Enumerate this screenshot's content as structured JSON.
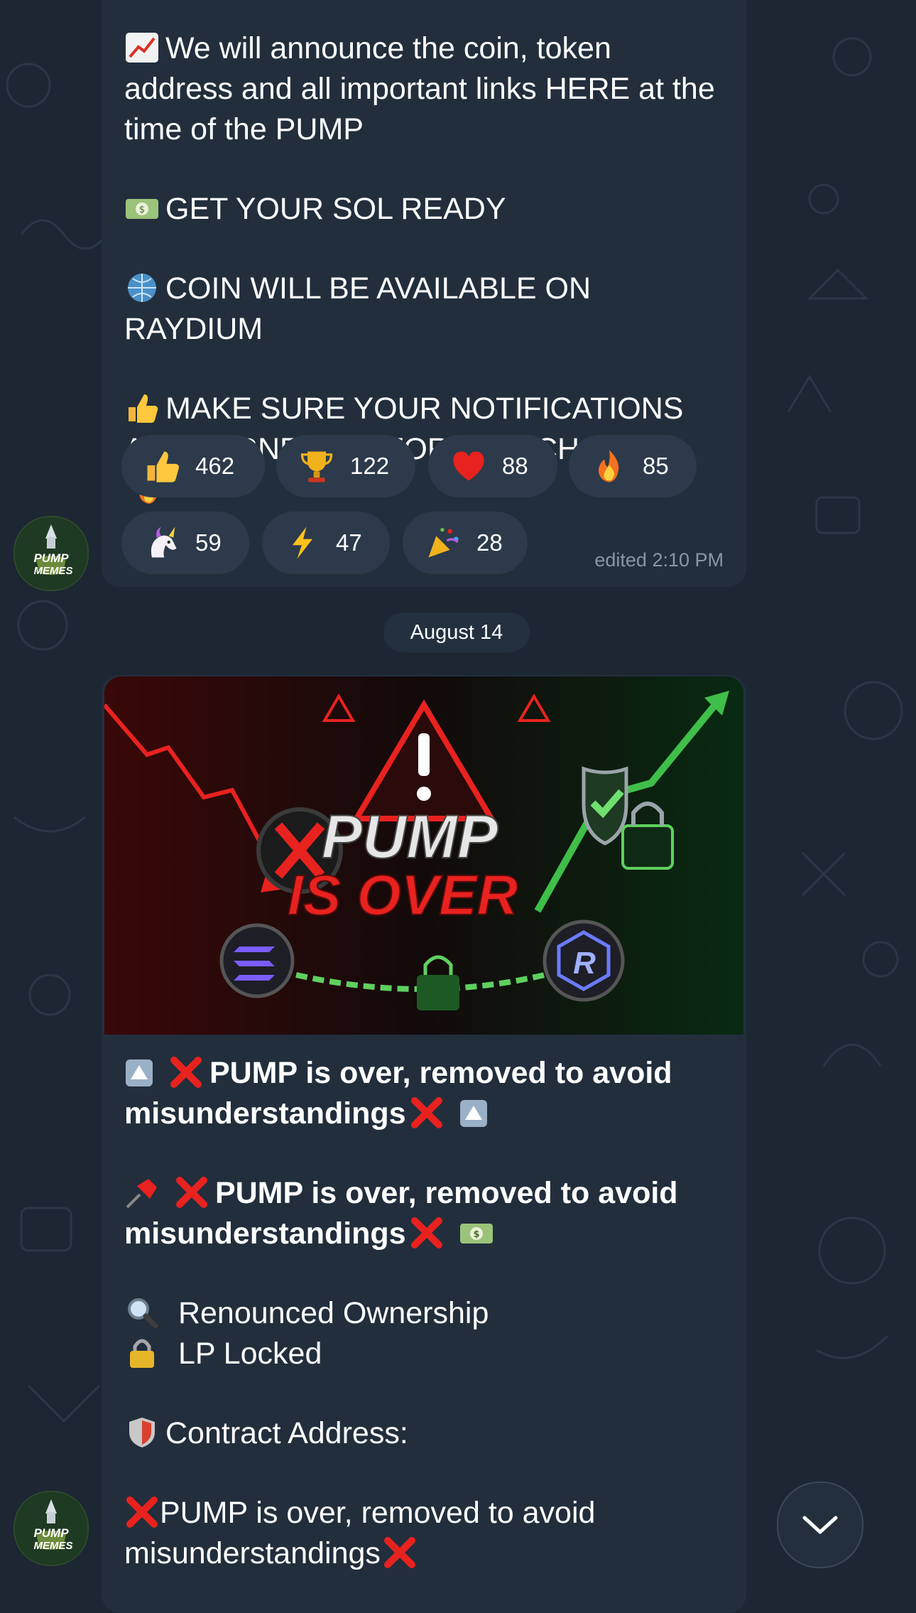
{
  "message1": {
    "line1": "We will announce the coin, token address and all important links HERE at the time of the PUMP",
    "line2": "GET YOUR SOL READY",
    "line3": "COIN WILL BE AVAILABLE ON RAYDIUM",
    "line4": "MAKE SURE YOUR NOTIFICATIONS ARE TURNED ON FOR THIS CHANNEL",
    "reactions": [
      {
        "emoji": "thumbs-up-icon",
        "count": "462"
      },
      {
        "emoji": "trophy-icon",
        "count": "122"
      },
      {
        "emoji": "heart-icon",
        "count": "88"
      },
      {
        "emoji": "fire-icon",
        "count": "85"
      },
      {
        "emoji": "unicorn-icon",
        "count": "59"
      },
      {
        "emoji": "lightning-icon",
        "count": "47"
      },
      {
        "emoji": "party-popper-icon",
        "count": "28"
      }
    ],
    "meta": "edited 2:10 PM"
  },
  "date_separator": "August 14",
  "message2": {
    "image_text": {
      "top": "PUMP",
      "bottom": "IS OVER"
    },
    "line1": "PUMP is over, removed to avoid misunderstandings",
    "line2": "PUMP is over, removed to avoid misunderstandings",
    "line3": "Renounced Ownership",
    "line4": "LP Locked",
    "line5": "Contract Address:",
    "line6": "PUMP is over, removed to avoid misunderstandings"
  },
  "channel_avatar_text": {
    "top": "PUMP",
    "bottom": "MEMES"
  },
  "colors": {
    "background": "#1c2733",
    "bubble": "#222e3c",
    "reaction": "#2c3a4b",
    "meta": "#8796a8"
  }
}
